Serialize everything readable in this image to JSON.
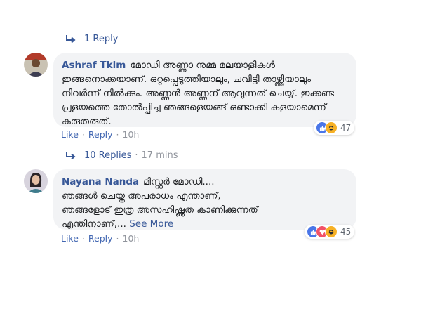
{
  "top_replies": {
    "label": "1 Reply"
  },
  "comment1": {
    "author": "Ashraf Tklm",
    "text": "മോഡി അണ്ണാ നുമ്മ മലയാളികൾ ഇങ്ങനൊക്കയാണ്. ഒറ്റപ്പെടുത്തിയാലും, ചവിട്ടി താഴ്ത്തിയാലും നിവർന്ന് നിൽക്കും. അണ്ണൻ അണ്ണന് ആവുന്നത് ചെയ്യ്. ഇക്കണ്ട പ്രളയത്തെ തോൽപ്പിച്ച ഞങ്ങളെയങ്ങ് ഒണ്ടാക്കി കളയാമെന്ന് കരുതരുത്.",
    "like": "Like",
    "reply": "Reply",
    "time": "10h",
    "reaction_count": "47",
    "reactions": [
      "like-icon",
      "haha-icon"
    ]
  },
  "replies2": {
    "label": "10 Replies",
    "time": "17 mins"
  },
  "comment2": {
    "author": "Nayana Nanda",
    "line1": "മിസ്റ്റർ മോഡി....",
    "line2": "ഞങ്ങൾ ചെയ്ത അപരാധം എന്താണ്,",
    "line3": "ഞങ്ങളോട് ഇത്ര അസഹിഷ്ണുത കാണിക്കുന്നത്",
    "line4": "എന്തിനാണ്,...",
    "see_more": "See More",
    "like": "Like",
    "reply": "Reply",
    "time": "10h",
    "reaction_count": "45",
    "reactions": [
      "like-icon",
      "love-icon",
      "haha-icon"
    ]
  },
  "colors": {
    "link": "#385898",
    "bubble": "#f2f3f5",
    "meta": "#90949c"
  }
}
